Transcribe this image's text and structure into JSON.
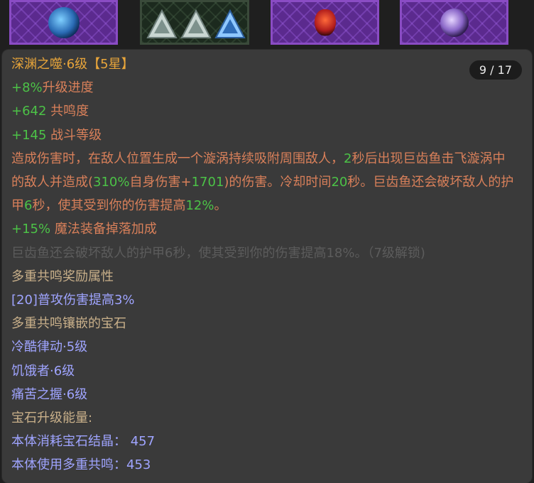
{
  "slots": [
    {
      "type": "gem-blue",
      "frame": "purple"
    },
    {
      "type": "triangles",
      "frame": "green"
    },
    {
      "type": "gem-red",
      "frame": "purple"
    },
    {
      "type": "gem-violet",
      "frame": "purple"
    }
  ],
  "tooltip": {
    "title": "深渊之噬·6级",
    "star_text": "【5星】",
    "page_counter": "9 / 17",
    "line_progress": {
      "value": "+8%",
      "label": "升级进度"
    },
    "line_resonance": {
      "value": "+642",
      "label": " 共鸣度"
    },
    "line_combat": {
      "value": "+145",
      "label": " 战斗等级"
    },
    "desc": {
      "p1": "造成伤害时，在敌人位置生成一个漩涡持续吸附周围敌人，",
      "n1": "2",
      "p2": "秒后出现巨齿鱼击飞漩涡中的敌人并造成(",
      "n2": "310%",
      "p3": "自身伤害+",
      "n3": "1701",
      "p4": ")的伤害。冷却时间",
      "n4": "20",
      "p5": "秒。巨齿鱼还会破坏敌人的护甲",
      "n5": "6",
      "p6": "秒，使其受到你的伤害提高",
      "n6": "12%",
      "p7": "。"
    },
    "line_drop": {
      "value": "+15%",
      "label": " 魔法装备掉落加成"
    },
    "locked_line": "巨齿鱼还会破坏敌人的护甲6秒，使其受到你的伤害提高18%。（7级解锁)",
    "multi_reward_title": "多重共鸣奖励属性",
    "multi_reward_item": "[20]普攻伤害提高3%",
    "socket_title": "多重共鸣镶嵌的宝石",
    "socket_gems": [
      "冷酷律动·5级",
      "饥饿者·6级",
      "痛苦之握·6级"
    ],
    "energy_title": "宝石升级能量:",
    "energy_crystal": "本体消耗宝石结晶：  457",
    "energy_multi": "本体使用多重共鸣：453"
  },
  "colors": {
    "title": "#e8a53a",
    "green": "#4cc247",
    "orange_text": "#d9805a",
    "muted": "#5c5c5c",
    "tan": "#c9b08a",
    "blue": "#9fa4ff",
    "panel_bg": "#3a3a3a"
  }
}
